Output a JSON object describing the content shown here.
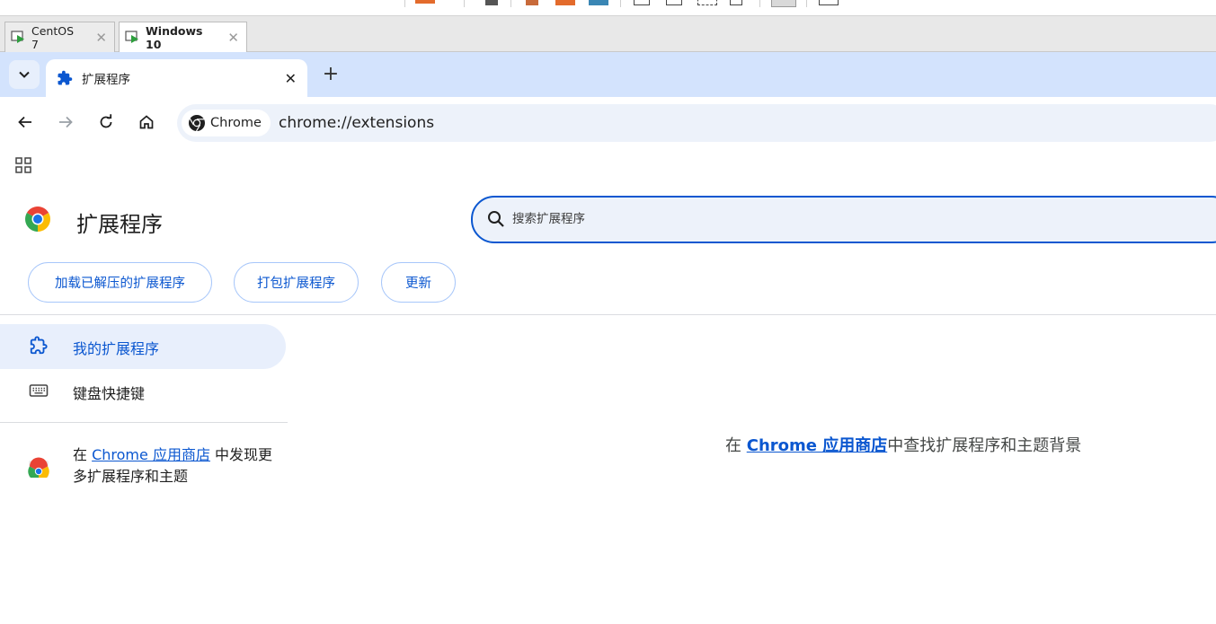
{
  "vm": {
    "tabs": [
      {
        "label": "CentOS 7",
        "active": false
      },
      {
        "label": "Windows 10",
        "active": true
      }
    ],
    "close_glyph": "✕"
  },
  "chrome": {
    "tab": {
      "title": "扩展程序",
      "close_glyph": "✕"
    },
    "new_tab_glyph": "+",
    "omnibox": {
      "chip_label": "Chrome",
      "url": "chrome://extensions"
    }
  },
  "page": {
    "title": "扩展程序",
    "search": {
      "placeholder": "搜索扩展程序"
    },
    "buttons": {
      "load_unpacked": "加载已解压的扩展程序",
      "pack": "打包扩展程序",
      "update": "更新"
    },
    "sidebar": {
      "items": [
        {
          "label": "我的扩展程序",
          "selected": true,
          "icon": "extension-icon"
        },
        {
          "label": "键盘快捷键",
          "selected": false,
          "icon": "keyboard-icon"
        }
      ],
      "store": {
        "prefix": "在 ",
        "link": "Chrome 应用商店",
        "suffix": " 中发现更多扩展程序和主题"
      }
    },
    "empty_state": {
      "prefix": "在 ",
      "link": "Chrome 应用商店",
      "suffix": "中查找扩展程序和主题背景"
    }
  },
  "colors": {
    "accent": "#0b57d0",
    "tab_strip": "#d3e3fd",
    "omnibox_bg": "#edf2fa",
    "selected_bg": "#e8effc"
  }
}
